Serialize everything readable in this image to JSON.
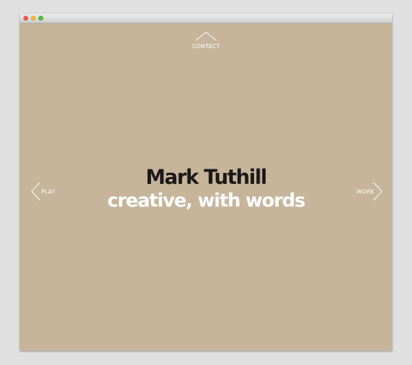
{
  "window": {
    "controls": [
      "close",
      "minimize",
      "maximize"
    ]
  },
  "nav": {
    "top": {
      "label": "CONTACT",
      "icon": "chevron-up-icon"
    },
    "left": {
      "label": "PLAY",
      "icon": "chevron-left-icon"
    },
    "right": {
      "label": "WORK",
      "icon": "chevron-right-icon"
    }
  },
  "hero": {
    "name": "Mark Tuthill",
    "tagline": "creative, with words"
  },
  "colors": {
    "background": "#c6b59b",
    "name_text": "#1c1a18",
    "tagline_text": "#ffffff",
    "nav_text": "#ffffff"
  }
}
